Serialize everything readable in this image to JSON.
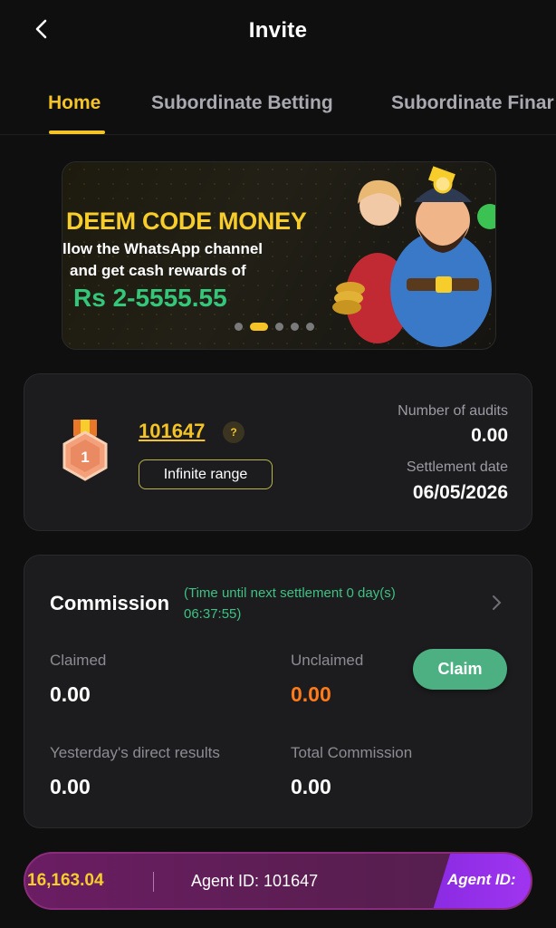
{
  "header": {
    "title": "Invite"
  },
  "tabs": [
    {
      "label": "Home"
    },
    {
      "label": "Subordinate Betting"
    },
    {
      "label": "Subordinate Finar"
    }
  ],
  "banner": {
    "title": "DEEM CODE MONEY",
    "line1": "llow the  WhatsApp channel",
    "line2": "and get cash rewards of",
    "amount": "Rs  2-5555.55",
    "slide_count": 5,
    "active_slide": 1
  },
  "agent_card": {
    "level": "1",
    "code": "101647",
    "help": "?",
    "range": "Infinite range",
    "audits_label": "Number of audits",
    "audits_value": "0.00",
    "settlement_label": "Settlement date",
    "settlement_value": "06/05/2026"
  },
  "commission": {
    "title": "Commission",
    "note": "(Time until next settlement 0 day(s) 06:37:55)",
    "claimed_label": "Claimed",
    "claimed_value": "0.00",
    "unclaimed_label": "Unclaimed",
    "unclaimed_value": "0.00",
    "claim_button": "Claim",
    "yesterday_label": "Yesterday's direct results",
    "yesterday_value": "0.00",
    "total_label": "Total Commission",
    "total_value": "0.00"
  },
  "bottom_bar": {
    "amount": "16,163.04",
    "agent_text": "Agent ID: 101647",
    "tag": "Agent ID:"
  },
  "colors": {
    "accent": "#f4c326",
    "green": "#4db082",
    "orange": "#ff7a1a",
    "background": "#0f0f10",
    "card": "#1c1c1e"
  }
}
